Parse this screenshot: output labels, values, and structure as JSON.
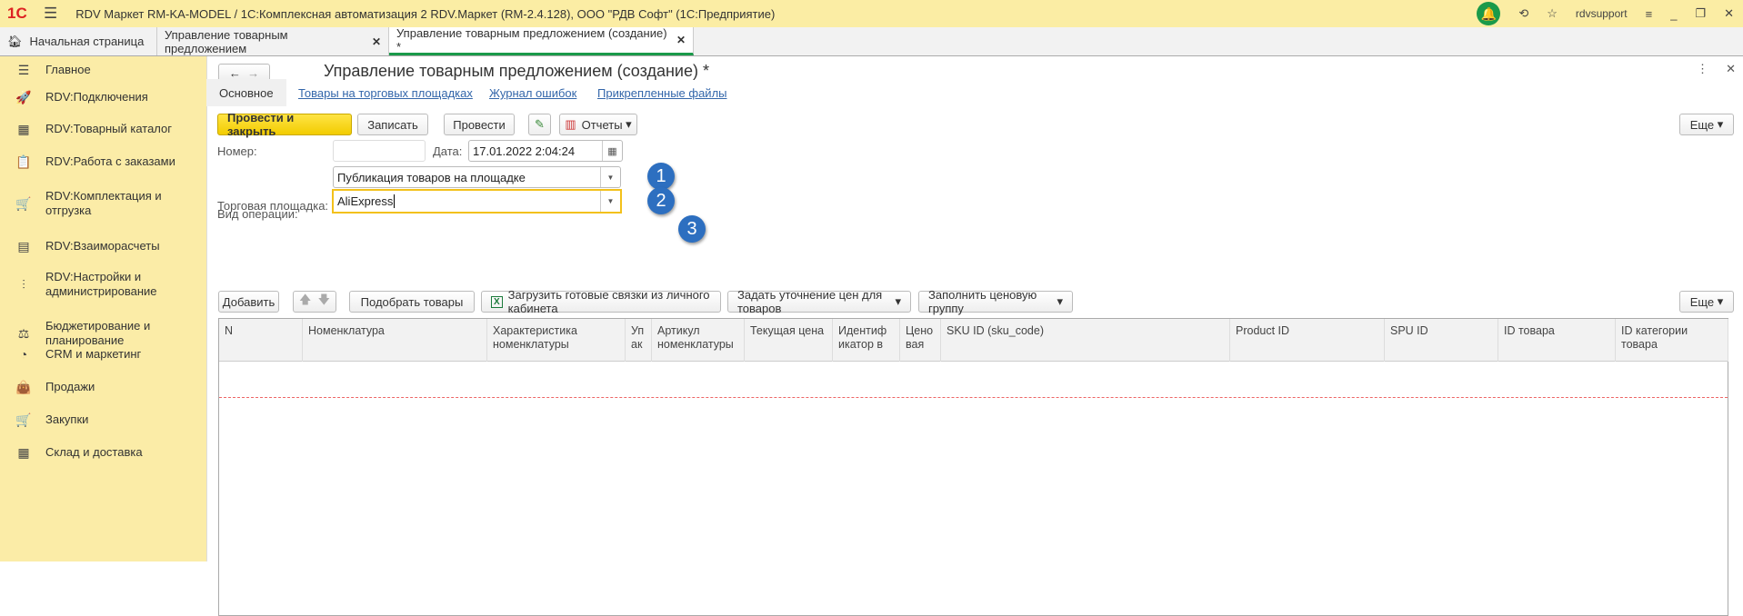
{
  "app": {
    "logo": "1С",
    "title": "RDV Маркет RM-KA-MODEL / 1С:Комплексная автоматизация 2 RDV.Маркет (RM-2.4.128), ООО \"РДВ Софт\"  (1С:Предприятие)",
    "user": "rdvsupport"
  },
  "tabs": [
    {
      "label": "Начальная страница"
    },
    {
      "label": "Управление товарным предложением"
    },
    {
      "label": "Управление товарным предложением (создание) *"
    }
  ],
  "sidebar": [
    {
      "label": "Главное",
      "icon": "☰"
    },
    {
      "label": "RDV:Подключения",
      "icon": "🚀"
    },
    {
      "label": "RDV:Товарный каталог",
      "icon": "▦"
    },
    {
      "label": "RDV:Работа с заказами",
      "icon": "📋"
    },
    {
      "label": "RDV:Комплектация и отгрузка",
      "icon": "🛒"
    },
    {
      "label": "RDV:Взаиморасчеты",
      "icon": "▤"
    },
    {
      "label": "RDV:Настройки и администрирование",
      "icon": "⫶"
    },
    {
      "label": "Бюджетирование и планирование",
      "icon": "⚖"
    },
    {
      "label": "CRM и маркетинг",
      "icon": "◔"
    },
    {
      "label": "Продажи",
      "icon": "👜"
    },
    {
      "label": "Закупки",
      "icon": "🛒"
    },
    {
      "label": "Склад и доставка",
      "icon": "▦"
    }
  ],
  "form": {
    "title": "Управление товарным предложением (создание) *",
    "subtabs": [
      "Основное",
      "Товары на торговых площадках",
      "Журнал ошибок",
      "Прикрепленные файлы"
    ],
    "toolbar": {
      "post_close": "Провести и закрыть",
      "save": "Записать",
      "post": "Провести",
      "reports": "Отчеты",
      "more": "Еще"
    },
    "number_label": "Номер:",
    "number_value": "",
    "date_label": "Дата:",
    "date_value": "17.01.2022  2:04:24",
    "op_label": "Вид операции:",
    "op_value": "Публикация товаров на площадке",
    "market_label": "Торговая площадка:",
    "market_value": "AliExpress",
    "badges": [
      "1",
      "2",
      "3"
    ],
    "table_toolbar": {
      "add": "Добавить",
      "pick": "Подобрать товары",
      "load": "Загрузить готовые связки из личного кабинета",
      "prices": "Задать уточнение цен для товаров",
      "fill": "Заполнить ценовую группу",
      "more": "Еще"
    },
    "columns": [
      "N",
      "Номенклатура",
      "Характеристика номенклатуры",
      "Уп ак",
      "Артикул номенклатуры",
      "Текущая цена",
      "Идентиф икатор в",
      "Цено вая",
      "SKU ID (sku_code)",
      "Product ID",
      "SPU ID",
      "ID товара",
      "ID категории товара"
    ]
  }
}
